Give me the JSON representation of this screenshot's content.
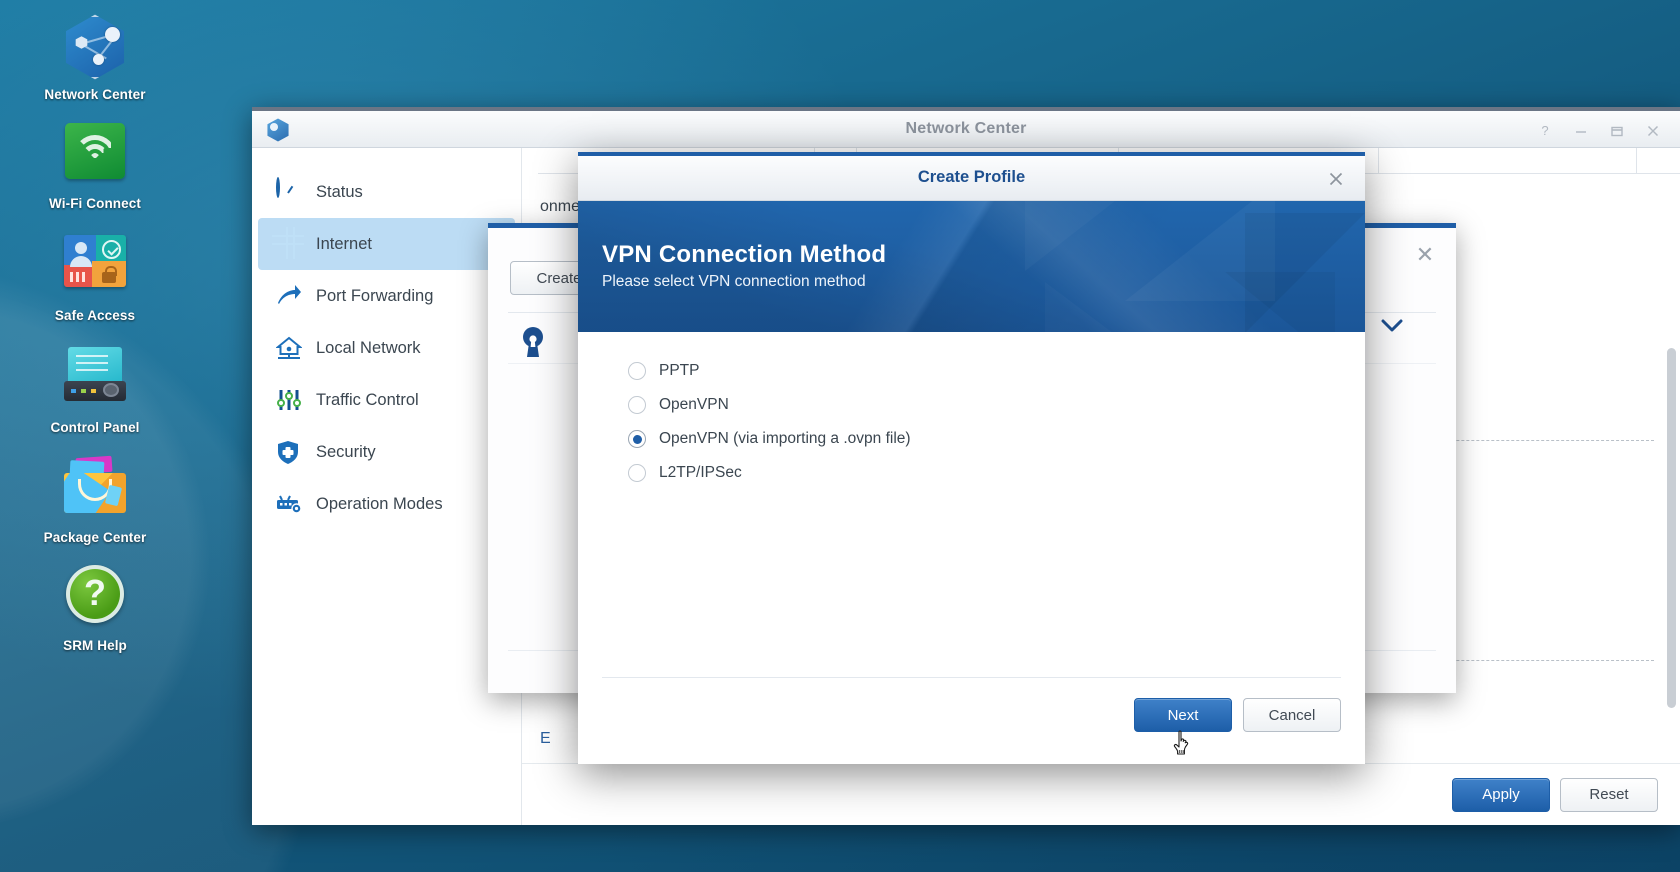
{
  "desktop": {
    "icons": [
      {
        "label": "Network Center",
        "icon": "network-center-icon"
      },
      {
        "label": "Wi-Fi Connect",
        "icon": "wifi-icon"
      },
      {
        "label": "Safe Access",
        "icon": "safe-access-icon"
      },
      {
        "label": "Control Panel",
        "icon": "control-panel-icon"
      },
      {
        "label": "Package Center",
        "icon": "package-center-icon"
      },
      {
        "label": "SRM Help",
        "icon": "help-question-icon"
      }
    ]
  },
  "window": {
    "title": "Network Center",
    "app_icon": "network-center-hex-icon",
    "controls": [
      {
        "name": "help",
        "glyph": "?"
      },
      {
        "name": "minimize",
        "glyph": "—"
      },
      {
        "name": "maximize",
        "glyph": "▭"
      },
      {
        "name": "close",
        "glyph": "✕"
      }
    ]
  },
  "sidebar": {
    "items": [
      {
        "label": "Status",
        "icon": "gauge-icon",
        "active": false
      },
      {
        "label": "Internet",
        "icon": "globe-icon",
        "active": true
      },
      {
        "label": "Port Forwarding",
        "icon": "forward-arrow-icon",
        "active": false
      },
      {
        "label": "Local Network",
        "icon": "home-icon",
        "active": false
      },
      {
        "label": "Traffic Control",
        "icon": "sliders-icon",
        "active": false
      },
      {
        "label": "Security",
        "icon": "shield-icon",
        "active": false
      },
      {
        "label": "Operation Modes",
        "icon": "router-gear-icon",
        "active": false
      }
    ]
  },
  "content": {
    "description_fragment": "onment. Consult your ISP if you require",
    "bottom_letter_fragment": "E",
    "footer": {
      "apply_label": "Apply",
      "reset_label": "Reset"
    }
  },
  "inner_window": {
    "create_label": "Create",
    "close_glyph": "✕",
    "lock_icon": "keyhole-icon",
    "chevron_icon": "chevron-down-icon"
  },
  "dialog": {
    "title": "Create Profile",
    "close_glyph": "✕",
    "banner": {
      "heading": "VPN Connection Method",
      "subheading": "Please select VPN connection method",
      "background_color": "#1f5ea7"
    },
    "options": [
      {
        "label": "PPTP",
        "selected": false
      },
      {
        "label": "OpenVPN",
        "selected": false
      },
      {
        "label": "OpenVPN (via importing a .ovpn file)",
        "selected": true
      },
      {
        "label": "L2TP/IPSec",
        "selected": false
      }
    ],
    "buttons": {
      "next_label": "Next",
      "cancel_label": "Cancel"
    },
    "accent_color": "#1f5ea7"
  }
}
